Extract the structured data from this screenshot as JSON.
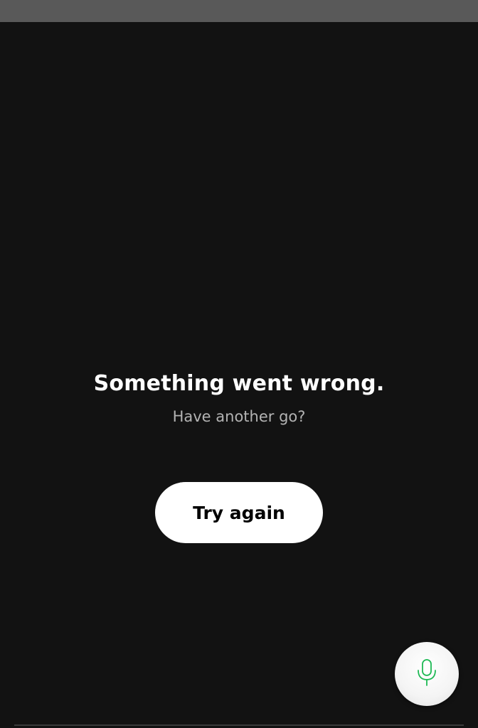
{
  "error": {
    "title": "Something went wrong.",
    "subtitle": "Have another go?"
  },
  "actions": {
    "retry_label": "Try again"
  },
  "voice_button": {
    "icon": "microphone-icon",
    "icon_color": "#1DB954"
  },
  "colors": {
    "background": "#121212",
    "status_bar": "#595959",
    "accent": "#1DB954"
  }
}
